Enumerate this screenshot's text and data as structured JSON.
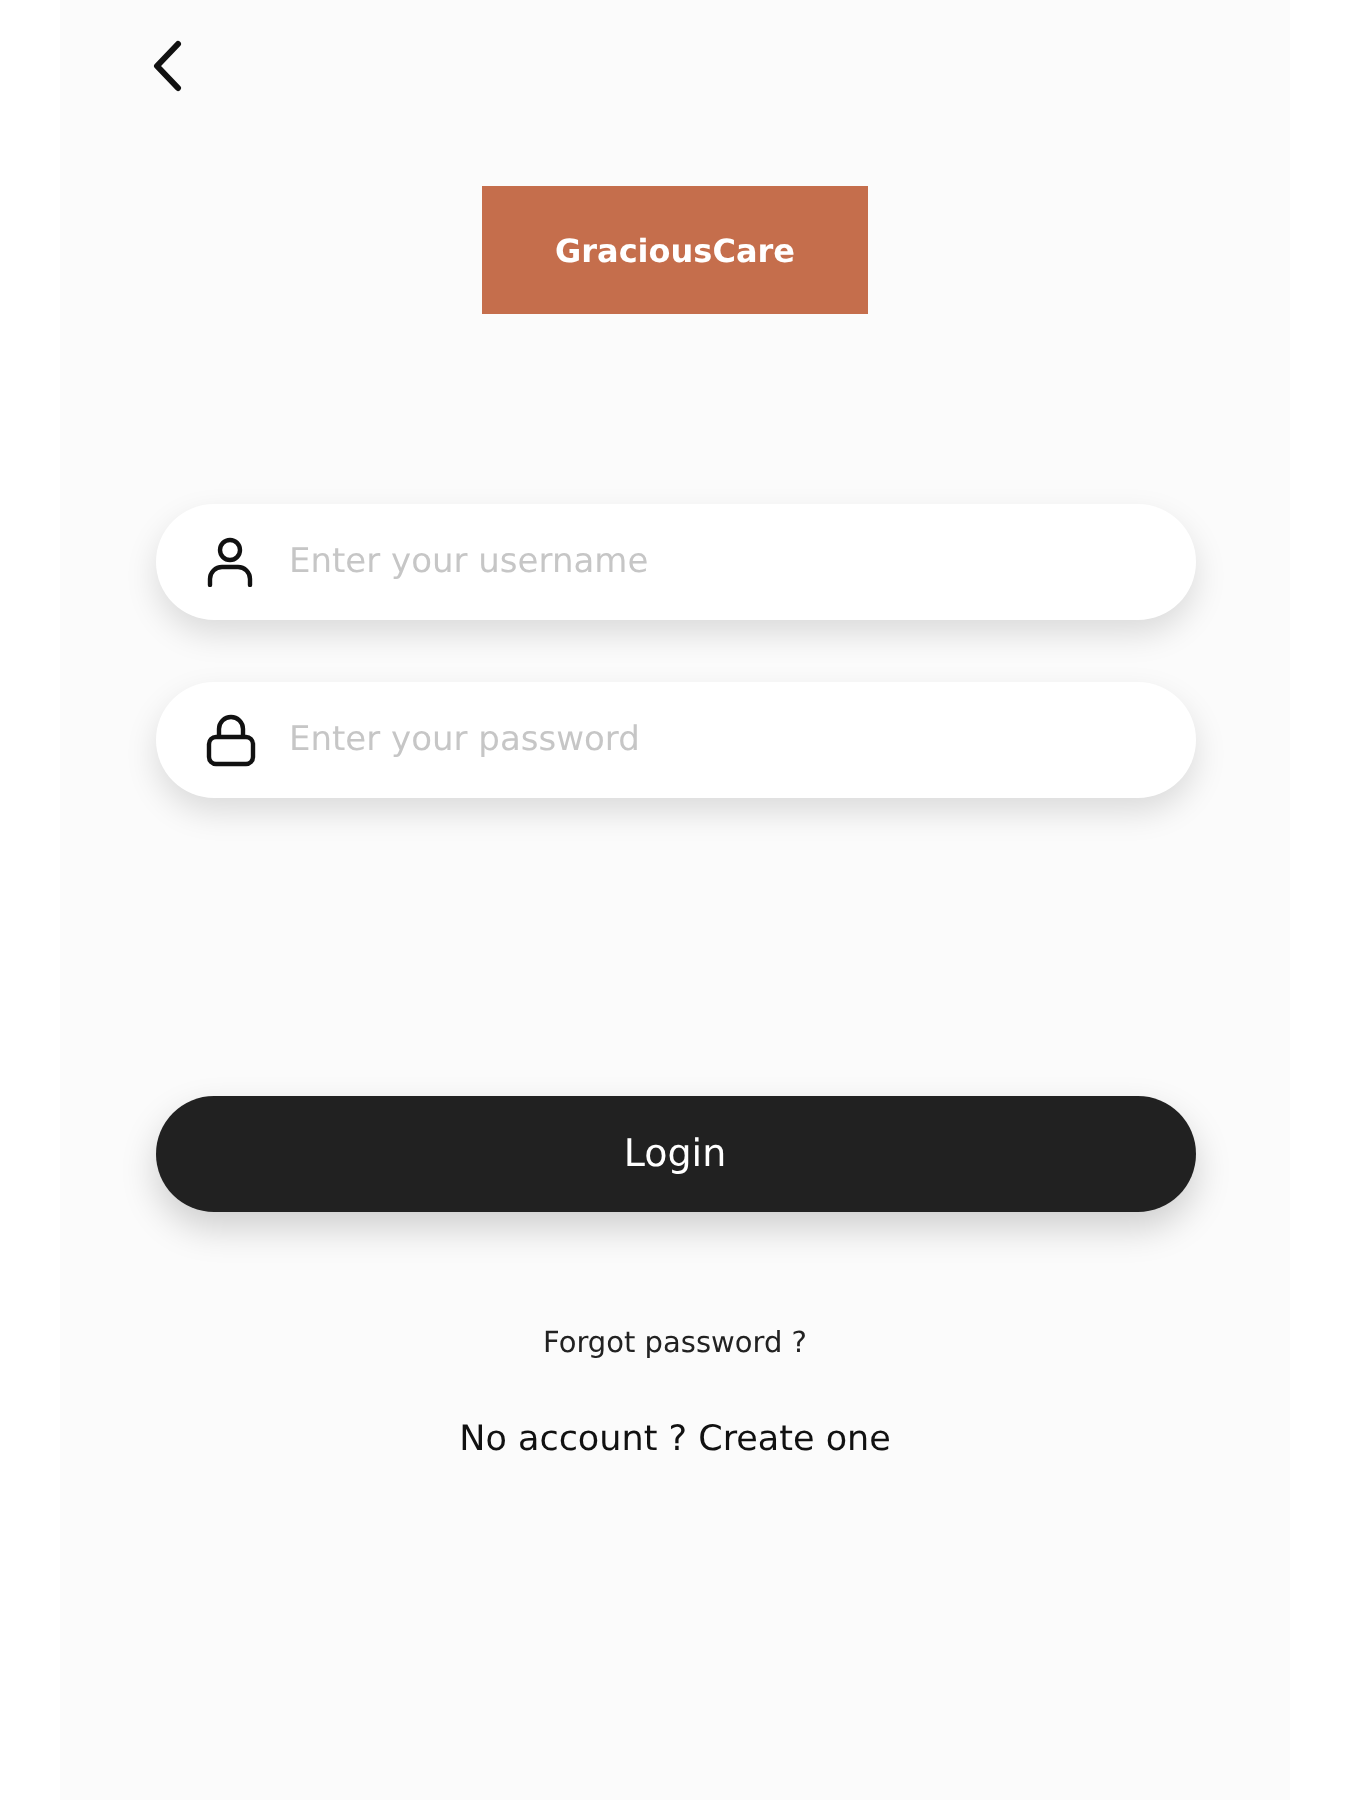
{
  "logo": {
    "text": "GraciousCare"
  },
  "fields": [
    {
      "kind": "username",
      "placeholder": "Enter your username"
    },
    {
      "kind": "password",
      "placeholder": "Enter your password"
    }
  ],
  "login_button": {
    "label": "Login"
  },
  "forgot_password": {
    "label": "Forgot password ?"
  },
  "signup_link": {
    "label": "No account ? Create one"
  }
}
